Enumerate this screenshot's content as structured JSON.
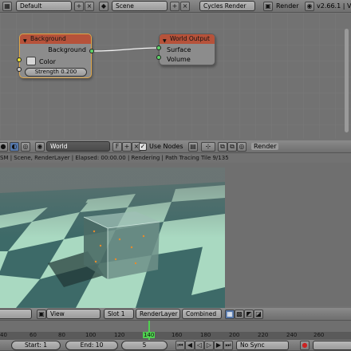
{
  "top_header": {
    "screen_layout": "Default",
    "scene": "Scene",
    "render_engine": "Cycles Render",
    "render_menu": "Render",
    "version": "v2.66.1 | Ve"
  },
  "node_editor": {
    "background_node": {
      "title": "Background",
      "output_label": "Background",
      "color_label": "Color",
      "strength_label": "Strength 0.200"
    },
    "world_output_node": {
      "title": "World Output",
      "surface_label": "Surface",
      "volume_label": "Volume"
    }
  },
  "node_header": {
    "world_name": "World",
    "use_nodes": "Use Nodes",
    "render_label": "Render",
    "fake_user": "F",
    "add_icon": "+",
    "close_icon": "×"
  },
  "render_info": {
    "status": "SM | Scene, RenderLayer | Elapsed: 00:00.00 | Rendering | Path Tracing Tile 9/135"
  },
  "image_editor_header": {
    "view_menu": "View",
    "slot": "Slot 1",
    "render_layer": "RenderLayer",
    "pass": "Combined"
  },
  "timeline": {
    "ticks": [
      "40",
      "60",
      "80",
      "100",
      "120",
      "140",
      "160",
      "180",
      "200",
      "220",
      "240",
      "260"
    ],
    "current_frame_tick": "140",
    "start": "Start: 1",
    "end": "End: 10",
    "current": "5",
    "sync": "No Sync"
  },
  "colors": {
    "node_header": "#b6523a",
    "socket_green": "#5fd36a",
    "socket_yellow": "#e8e23a",
    "socket_gray": "#c7c7c7",
    "floor_light": "#a9d9c1",
    "floor_dark": "#3d6a68",
    "playhead": "#4fd14f"
  }
}
